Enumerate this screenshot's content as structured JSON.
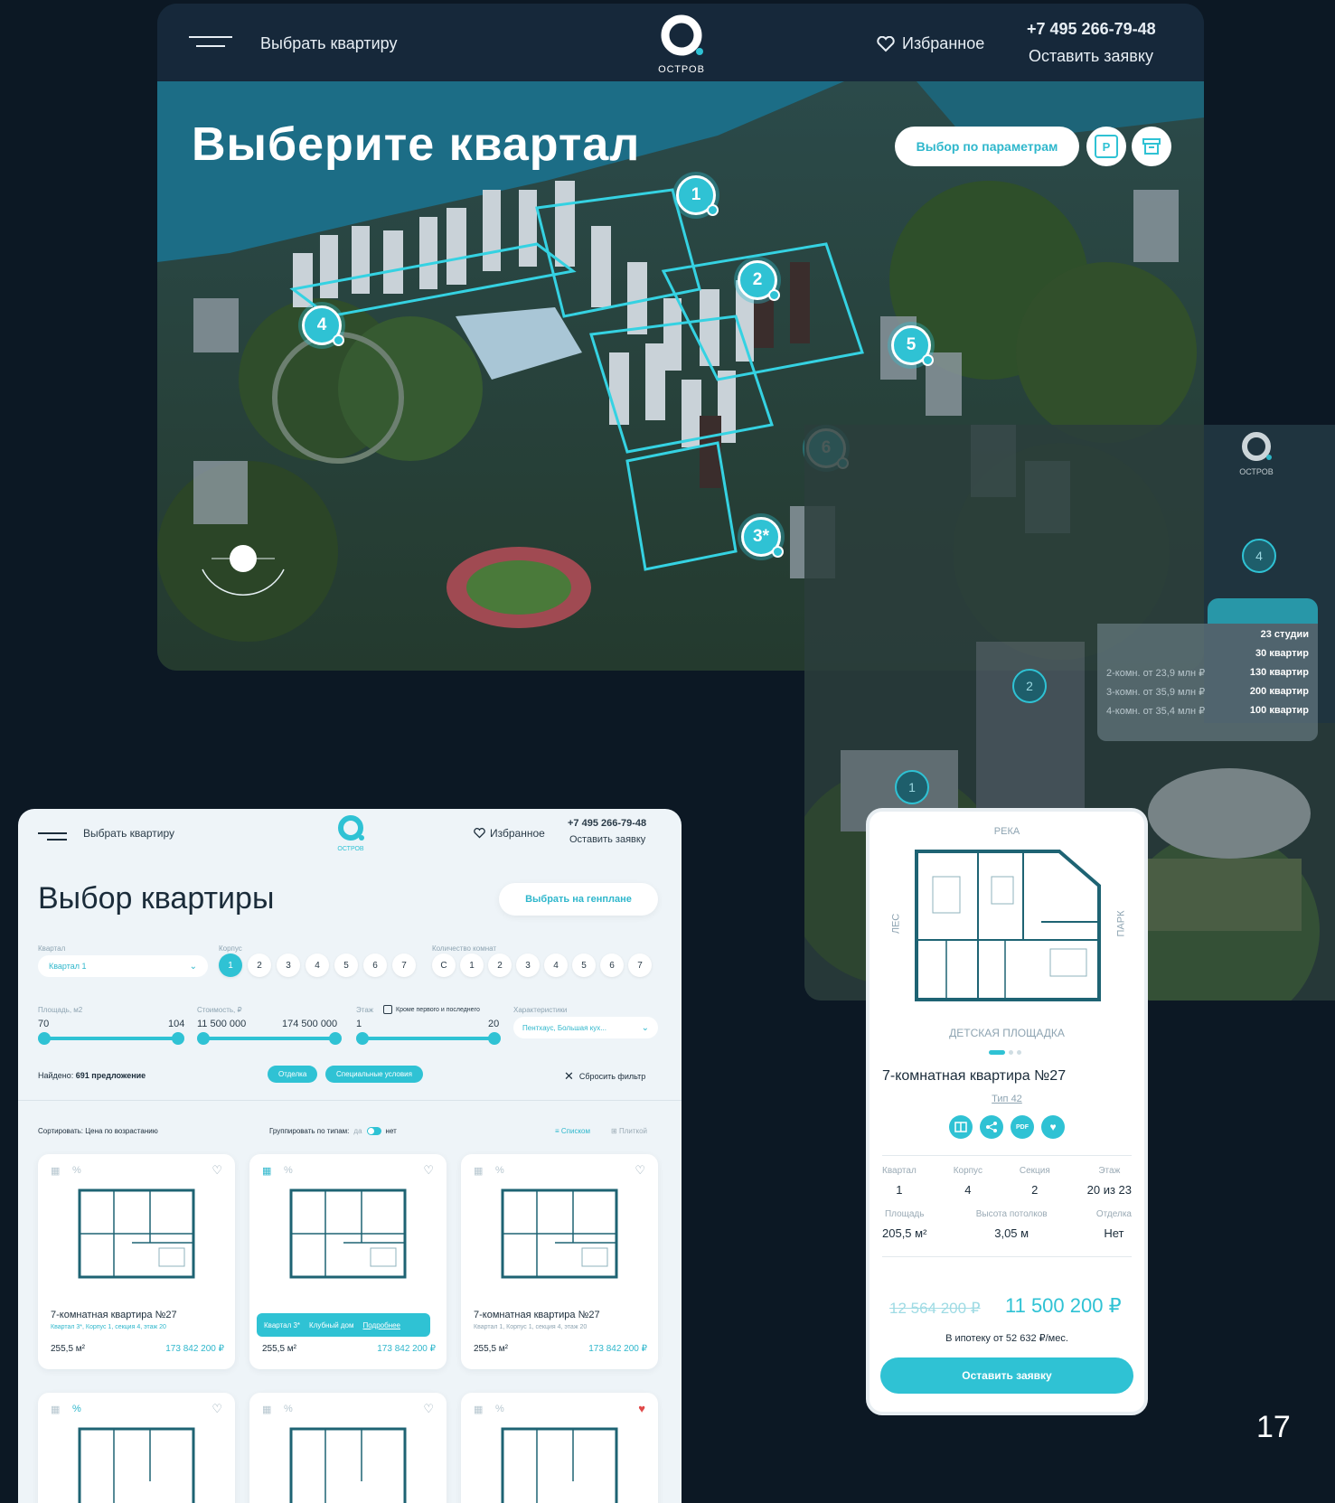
{
  "top": {
    "menu_label": "Выбрать квартиру",
    "logo_text": "ОСТРОВ",
    "favorites_label": "Избранное",
    "phone": "+7 495 266-79-48",
    "request_label": "Оставить заявку",
    "hero_title": "Выберите квартал",
    "params_button": "Выбор по параметрам",
    "pins": [
      "1",
      "2",
      "3*",
      "4",
      "5",
      "6"
    ]
  },
  "right_preview": {
    "logo_text": "ОСТРОВ",
    "pins": [
      "4",
      "2",
      "1"
    ],
    "stats": [
      {
        "label": "",
        "value": "23 студии"
      },
      {
        "label": "",
        "value": "30 квартир"
      },
      {
        "label": "2-комн. от 23,9 млн ₽",
        "value": "130 квартир"
      },
      {
        "label": "3-комн. от 35,9 млн ₽",
        "value": "200 квартир"
      },
      {
        "label": "4-комн. от 35,4 млн ₽",
        "value": "100 квартир"
      }
    ]
  },
  "catalog": {
    "menu_label": "Выбрать квартиру",
    "logo_text": "ОСТРОВ",
    "favorites_label": "Избранное",
    "phone": "+7 495 266-79-48",
    "request_label": "Оставить заявку",
    "title": "Выбор квартиры",
    "genplan_button": "Выбрать на генплане",
    "filters": {
      "kvartal_label": "Квартал",
      "kvartal_value": "Квартал 1",
      "korpus_label": "Корпус",
      "korpus_options": [
        "1",
        "2",
        "3",
        "4",
        "5",
        "6",
        "7"
      ],
      "rooms_label": "Количество комнат",
      "rooms_options": [
        "С",
        "1",
        "2",
        "3",
        "4",
        "5",
        "6",
        "7"
      ],
      "area_label": "Площадь, м2",
      "area_min": "70",
      "area_max": "104",
      "price_label": "Стоимость, ₽",
      "price_min": "11 500 000",
      "price_max": "174 500 000",
      "floor_label": "Этаж",
      "floor_check": "Кроме первого и последнего",
      "floor_min": "1",
      "floor_max": "20",
      "features_label": "Характеристики",
      "features_value": "Пентхаус, Большая кух..."
    },
    "found_label": "Найдено:",
    "found_value": "691 предложение",
    "tag_finish": "Отделка",
    "tag_special": "Специальные условия",
    "reset_label": "Сбросить фильтр",
    "sort_label": "Сортировать: Цена по возрастанию",
    "group_label": "Группировать по типам:",
    "group_yes": "да",
    "group_no": "нет",
    "view_list": "Списком",
    "view_tiles": "Плиткой",
    "cards": [
      {
        "title": "7-комнатная квартира №27",
        "sub": "Квартал 3*, Корпус 1, секция 4, этаж 20",
        "area": "255,5 м²",
        "price": "173 842 200 ₽"
      },
      {
        "title": "7-комнатная квартира №27",
        "sub": "",
        "area": "255,5 м²",
        "price": "173 842 200 ₽",
        "tooltip": {
          "a": "Квартал 3*",
          "b": "Клубный дом",
          "c": "Подробнее"
        }
      },
      {
        "title": "7-комнатная квартира №27",
        "sub": "Квартал 1, Корпус 1, секция 4, этаж 20",
        "area": "255,5 м²",
        "price": "173 842 200 ₽"
      }
    ]
  },
  "phone_card": {
    "top_label": "РЕКА",
    "left_label": "ЛЕС",
    "right_label": "ПАРК",
    "bottom_label": "ДЕТСКАЯ ПЛОЩАДКА",
    "title": "7-комнатная квартира №27",
    "type_link": "Тип 42",
    "icon_pdf": "PDF",
    "specs": [
      {
        "label": "Квартал",
        "value": "1"
      },
      {
        "label": "Корпус",
        "value": "4"
      },
      {
        "label": "Секция",
        "value": "2"
      },
      {
        "label": "Этаж",
        "value": "20 из 23"
      }
    ],
    "specs2": [
      {
        "label": "Площадь",
        "value": "205,5 м²"
      },
      {
        "label": "Высота потолков",
        "value": "3,05 м"
      },
      {
        "label": "Отделка",
        "value": "Нет"
      }
    ],
    "old_price": "12 564 200 ₽",
    "price": "11 500 200 ₽",
    "mortgage": "В ипотеку от 52 632 ₽/мес.",
    "cta": "Оставить заявку"
  },
  "page_number": "17",
  "colors": {
    "accent": "#2fc2d4",
    "dark": "#0c1824",
    "header": "#16283a"
  }
}
